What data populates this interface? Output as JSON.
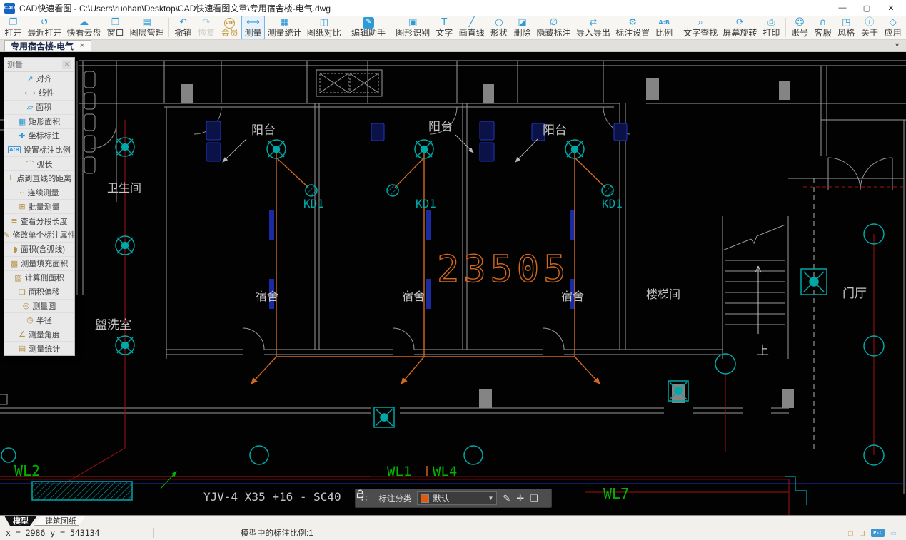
{
  "window": {
    "title": "CAD快速看图 - C:\\Users\\ruohan\\Desktop\\CAD快速看图文章\\专用宿舍楼-电气.dwg",
    "logo_text": "CAD",
    "controls": [
      {
        "name": "minimize",
        "glyph": "—"
      },
      {
        "name": "maximize",
        "glyph": "▢"
      },
      {
        "name": "close",
        "glyph": "✕"
      }
    ]
  },
  "toolbar": {
    "divider_after": [
      4,
      10,
      11,
      20,
      23
    ],
    "items": [
      {
        "name": "open",
        "label": "打开",
        "glyph": "❐"
      },
      {
        "name": "recent-open",
        "label": "最近打开",
        "glyph": "↺"
      },
      {
        "name": "cloud-drive",
        "label": "快看云盘",
        "glyph": "☁"
      },
      {
        "name": "window",
        "label": "窗口",
        "glyph": "❒"
      },
      {
        "name": "layer-manager",
        "label": "图层管理",
        "glyph": "▤"
      },
      {
        "name": "undo",
        "label": "撤销",
        "glyph": "↶"
      },
      {
        "name": "redo",
        "label": "恢复",
        "glyph": "↷",
        "disabled": true
      },
      {
        "name": "vip",
        "label": "会员",
        "glyph": "VIP",
        "tone": "gold",
        "vip": true
      },
      {
        "name": "measure",
        "label": "测量",
        "glyph": "⟷",
        "active": true
      },
      {
        "name": "measure-stats",
        "label": "测量统计",
        "glyph": "▦"
      },
      {
        "name": "drawing-compare",
        "label": "图纸对比",
        "glyph": "◫"
      },
      {
        "name": "edit-assistant",
        "label": "编辑助手",
        "glyph": "✎",
        "filled": true
      },
      {
        "name": "shape-recognition",
        "label": "图形识别",
        "glyph": "▣"
      },
      {
        "name": "text",
        "label": "文字",
        "glyph": "T"
      },
      {
        "name": "draw-line",
        "label": "画直线",
        "glyph": "╱"
      },
      {
        "name": "shape",
        "label": "形状",
        "glyph": "○"
      },
      {
        "name": "delete",
        "label": "删除",
        "glyph": "◪"
      },
      {
        "name": "hide-annotation",
        "label": "隐藏标注",
        "glyph": "∅"
      },
      {
        "name": "import-export",
        "label": "导入导出",
        "glyph": "⇄"
      },
      {
        "name": "annotation-settings",
        "label": "标注设置",
        "glyph": "⚙"
      },
      {
        "name": "scale",
        "label": "比例",
        "glyph": "A:B",
        "txt": true
      },
      {
        "name": "text-search",
        "label": "文字查找",
        "glyph": "⌕"
      },
      {
        "name": "screen-rotate",
        "label": "屏幕旋转",
        "glyph": "⟳"
      },
      {
        "name": "print",
        "label": "打印",
        "glyph": "⎙"
      },
      {
        "name": "account",
        "label": "账号",
        "glyph": "☺"
      },
      {
        "name": "customer-service",
        "label": "客服",
        "glyph": "∩"
      },
      {
        "name": "style",
        "label": "风格",
        "glyph": "◳"
      },
      {
        "name": "about",
        "label": "关于",
        "glyph": "ⓘ"
      },
      {
        "name": "apps",
        "label": "应用",
        "glyph": "◇"
      }
    ]
  },
  "tabbar": {
    "active_tab": "专用宿舍楼-电气",
    "close_glyph": "✕",
    "chevron": "▼"
  },
  "measure_panel": {
    "title": "测量",
    "close_glyph": "✕",
    "items": [
      {
        "name": "align",
        "label": "对齐",
        "glyph": "↗",
        "tone": "blue"
      },
      {
        "name": "linear",
        "label": "线性",
        "glyph": "⟷",
        "tone": "blue"
      },
      {
        "name": "area",
        "label": "面积",
        "glyph": "▱",
        "tone": "blue"
      },
      {
        "name": "rect-area",
        "label": "矩形面积",
        "glyph": "▦",
        "tone": "blue"
      },
      {
        "name": "coordinate",
        "label": "坐标标注",
        "glyph": "✚",
        "tone": "blue"
      },
      {
        "name": "set-annotation-scale",
        "label": "设置标注比例",
        "glyph": "A:B",
        "tone": "blue",
        "txt": true
      },
      {
        "name": "arc-length",
        "label": "弧长",
        "glyph": "⌒",
        "tone": "gold"
      },
      {
        "name": "point-to-line",
        "label": "点到直线的距离",
        "glyph": "⊥",
        "tone": "gold"
      },
      {
        "name": "continuous-measure",
        "label": "连续测量",
        "glyph": "⌣",
        "tone": "gold"
      },
      {
        "name": "batch-measure",
        "label": "批量测量",
        "glyph": "⊞",
        "tone": "gold"
      },
      {
        "name": "segment-length",
        "label": "查看分段长度",
        "glyph": "≡",
        "tone": "gold"
      },
      {
        "name": "edit-single-annotation",
        "label": "修改单个标注属性",
        "glyph": "✎",
        "tone": "gold"
      },
      {
        "name": "area-with-arc",
        "label": "面积(含弧线)",
        "glyph": "◗",
        "tone": "gold"
      },
      {
        "name": "fill-area",
        "label": "测量填充面积",
        "glyph": "▩",
        "tone": "gold"
      },
      {
        "name": "side-area",
        "label": "计算侧面积",
        "glyph": "▨",
        "tone": "gold"
      },
      {
        "name": "area-offset",
        "label": "面积偏移",
        "glyph": "❏",
        "tone": "gold"
      },
      {
        "name": "measure-circle",
        "label": "测量圆",
        "glyph": "◎",
        "tone": "gold"
      },
      {
        "name": "radius",
        "label": "半径",
        "glyph": "◷",
        "tone": "gold"
      },
      {
        "name": "measure-angle",
        "label": "测量角度",
        "glyph": "∠",
        "tone": "gold"
      },
      {
        "name": "measure-stats",
        "label": "测量统计",
        "glyph": "▤",
        "tone": "gold"
      }
    ]
  },
  "annotation_bar": {
    "grid_glyph": "∷",
    "label": "标注分类",
    "selected": "默认",
    "swatch_style": "background:#e25a10",
    "caret": "▼",
    "icons": [
      {
        "name": "edit",
        "glyph": "✎"
      },
      {
        "name": "move",
        "glyph": "✛"
      },
      {
        "name": "copy",
        "glyph": "❑"
      }
    ]
  },
  "sheet_tabs": [
    {
      "name": "model",
      "label": "模型",
      "active": true
    },
    {
      "name": "arch-drawing",
      "label": "建筑图纸",
      "active": false
    }
  ],
  "status_bar": {
    "coords": "x = 2986  y = 543134",
    "scale_text": "模型中的标注比例:1",
    "icons": [
      {
        "name": "export-image",
        "glyph": "❐",
        "tone": "gold"
      },
      {
        "name": "edit-export",
        "glyph": "❒",
        "tone": "gold"
      },
      {
        "name": "pc-sync",
        "text": "P-C",
        "tone": "blue"
      },
      {
        "name": "collapse",
        "glyph": "▭",
        "tone": "pale"
      }
    ]
  },
  "canvas": {
    "labels": {
      "balcony": "阳台",
      "dorm": "宿舍",
      "kd1": "KD1",
      "stairwell": "楼梯间",
      "hall": "门厅",
      "toilet": "卫生间",
      "washroom": "盥洗室",
      "up": "上",
      "wl1": "WL1",
      "wl2": "WL2",
      "wl4": "WL4",
      "wl7": "WL7",
      "cable_spec": "YJV-4 X35 +16 - SC40",
      "dimension": "23505"
    },
    "colors": {
      "background": "#020202",
      "wall": "#9a9a9a",
      "bright_line": "#d0d0d0",
      "column": "#848484",
      "teal": "#00a8a8",
      "orange": "#d2691e",
      "red": "#a01010",
      "dark_red": "#7a0c0c",
      "green": "#00b400",
      "blue": "#2337c0",
      "label": "#c4c4c4"
    }
  }
}
